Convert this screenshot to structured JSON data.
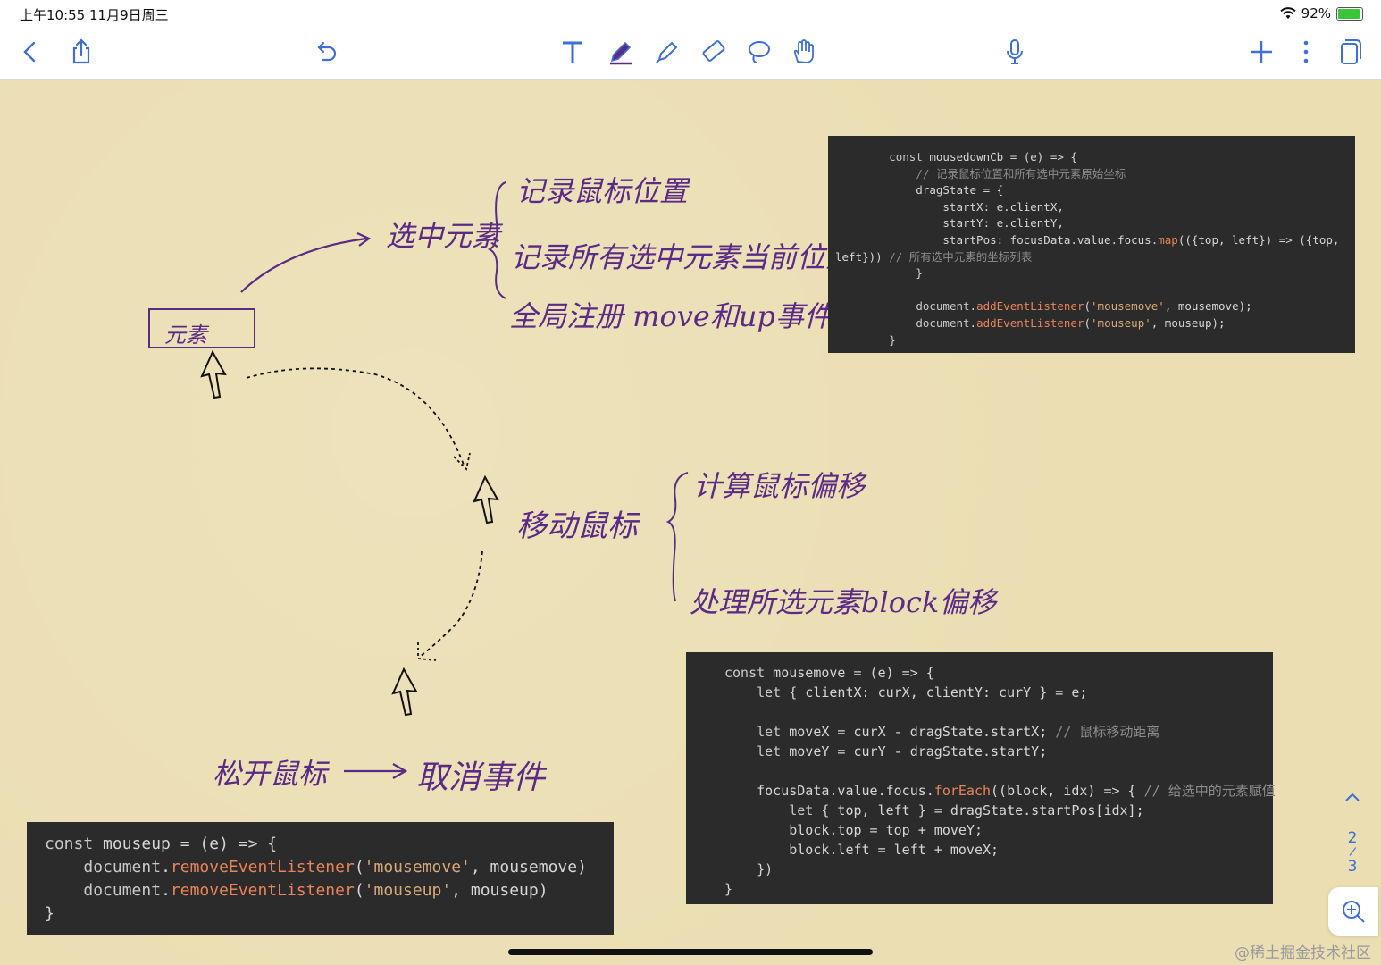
{
  "status_bar": {
    "time": "上午10:55   11月9日周三",
    "battery": "92%",
    "battery_level": 0.92
  },
  "toolbar": {
    "icons": [
      "back-icon",
      "share-icon",
      "undo-icon",
      "text-tool-icon",
      "pen-tool-icon",
      "highlighter-icon",
      "eraser-icon",
      "lasso-icon",
      "hand-icon",
      "microphone-icon",
      "add-icon",
      "more-icon",
      "pages-icon"
    ],
    "accent": "#3d6fd6"
  },
  "notes": {
    "element_box": "元素",
    "select": "选中元素",
    "select_items": [
      "记录鼠标位置",
      "记录所有选中元素当前位置",
      "全局注册 move和up事件"
    ],
    "move": "移动鼠标",
    "move_items": [
      "计算鼠标偏移",
      "处理所选元素block偏移"
    ],
    "release": "松开鼠标",
    "cancel": "取消事件",
    "ink_color": "#5a2a86"
  },
  "code_blocks": {
    "mousedown": [
      "        const mousedownCb = (e) => {",
      "            // 记录鼠标位置和所有选中元素原始坐标",
      "            dragState = {",
      "                startX: e.clientX,",
      "                startY: e.clientY,",
      "                startPos: focusData.value.focus.map(({top, left}) => ({top,",
      "left})) // 所有选中元素的坐标列表",
      "            }",
      "",
      "            document.addEventListener('mousemove', mousemove);",
      "            document.addEventListener('mouseup', mouseup);",
      "        }"
    ],
    "mousemove": [
      "const mousemove = (e) => {",
      "    let { clientX: curX, clientY: curY } = e;",
      "",
      "    let moveX = curX - dragState.startX; // 鼠标移动距离",
      "    let moveY = curY - dragState.startY;",
      "",
      "    focusData.value.focus.forEach((block, idx) => { // 给选中的元素赋值",
      "        let { top, left } = dragState.startPos[idx];",
      "        block.top = top + moveY;",
      "        block.left = left + moveX;",
      "    })",
      "}"
    ],
    "mouseup": [
      "const mouseup = (e) => {",
      "    document.removeEventListener('mousemove', mousemove)",
      "    document.removeEventListener('mouseup', mouseup)",
      "}"
    ]
  },
  "page_nav": {
    "current": "2",
    "separator": "/",
    "total": "3"
  },
  "watermark": "@稀土掘金技术社区"
}
